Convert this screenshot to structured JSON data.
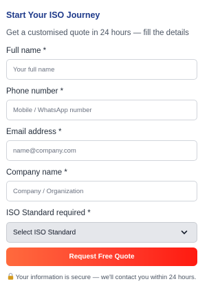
{
  "form": {
    "title": "Start Your ISO Journey",
    "subtitle": "Get a customised quote in 24 hours — fill the details",
    "fields": {
      "full_name": {
        "label": "Full name *",
        "placeholder": "Your full name"
      },
      "phone": {
        "label": "Phone number *",
        "placeholder": "Mobile / WhatsApp number"
      },
      "email": {
        "label": "Email address *",
        "placeholder": "name@company.com"
      },
      "company": {
        "label": "Company name *",
        "placeholder": "Company / Organization"
      },
      "iso_standard": {
        "label": "ISO Standard required *",
        "selected": "Select ISO Standard"
      }
    },
    "submit_label": "Request Free Quote",
    "secure_note": "Your information is secure — we'll contact you within 24 hours.",
    "colors": {
      "title": "#1e3a8a",
      "button_start": "#ff6a3d",
      "button_end": "#ff1a10",
      "lock": "#d49a1e"
    },
    "icons": {
      "lock": "lock-icon",
      "select_arrow": "chevron-down-icon"
    }
  }
}
